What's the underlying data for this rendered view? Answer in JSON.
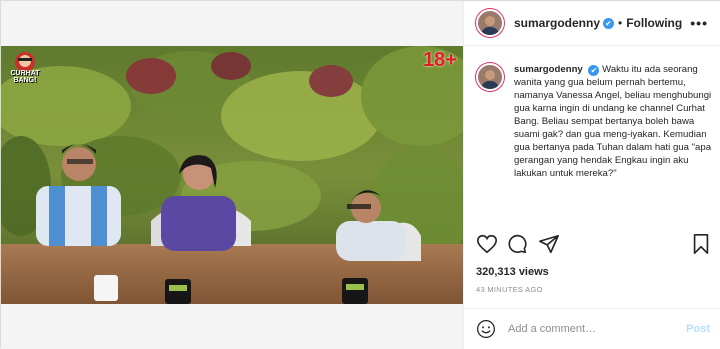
{
  "media": {
    "badge": "18+",
    "logo_text": "CURHAT BANG!"
  },
  "header": {
    "username": "sumargodenny",
    "verified": "✔",
    "separator": "•",
    "follow_status": "Following",
    "more": "•••"
  },
  "caption": {
    "username": "sumargodenny",
    "lines": [
      "Waktu itu ada seorang wanita yang gua belum pernah bertemu,",
      "namanya Vanessa Angel, beliau menghubungi gua karna ingin di undang ke channel Curhat Bang. Beliau sempat bertanya boleh bawa suami gak? dan gua meng-iyakan. Kemudian gua bertanya pada Tuhan dalam hati gua \"apa gerangan yang hendak Engkau ingin aku lakukan untuk mereka?\""
    ]
  },
  "actions": {
    "like_icon": "heart-icon",
    "comment_icon": "comment-icon",
    "share_icon": "share-icon",
    "save_icon": "bookmark-icon"
  },
  "stats": {
    "views": "320,313 views",
    "time_ago": "43 MINUTES AGO"
  },
  "comment": {
    "placeholder": "Add a comment…",
    "post_label": "Post"
  }
}
